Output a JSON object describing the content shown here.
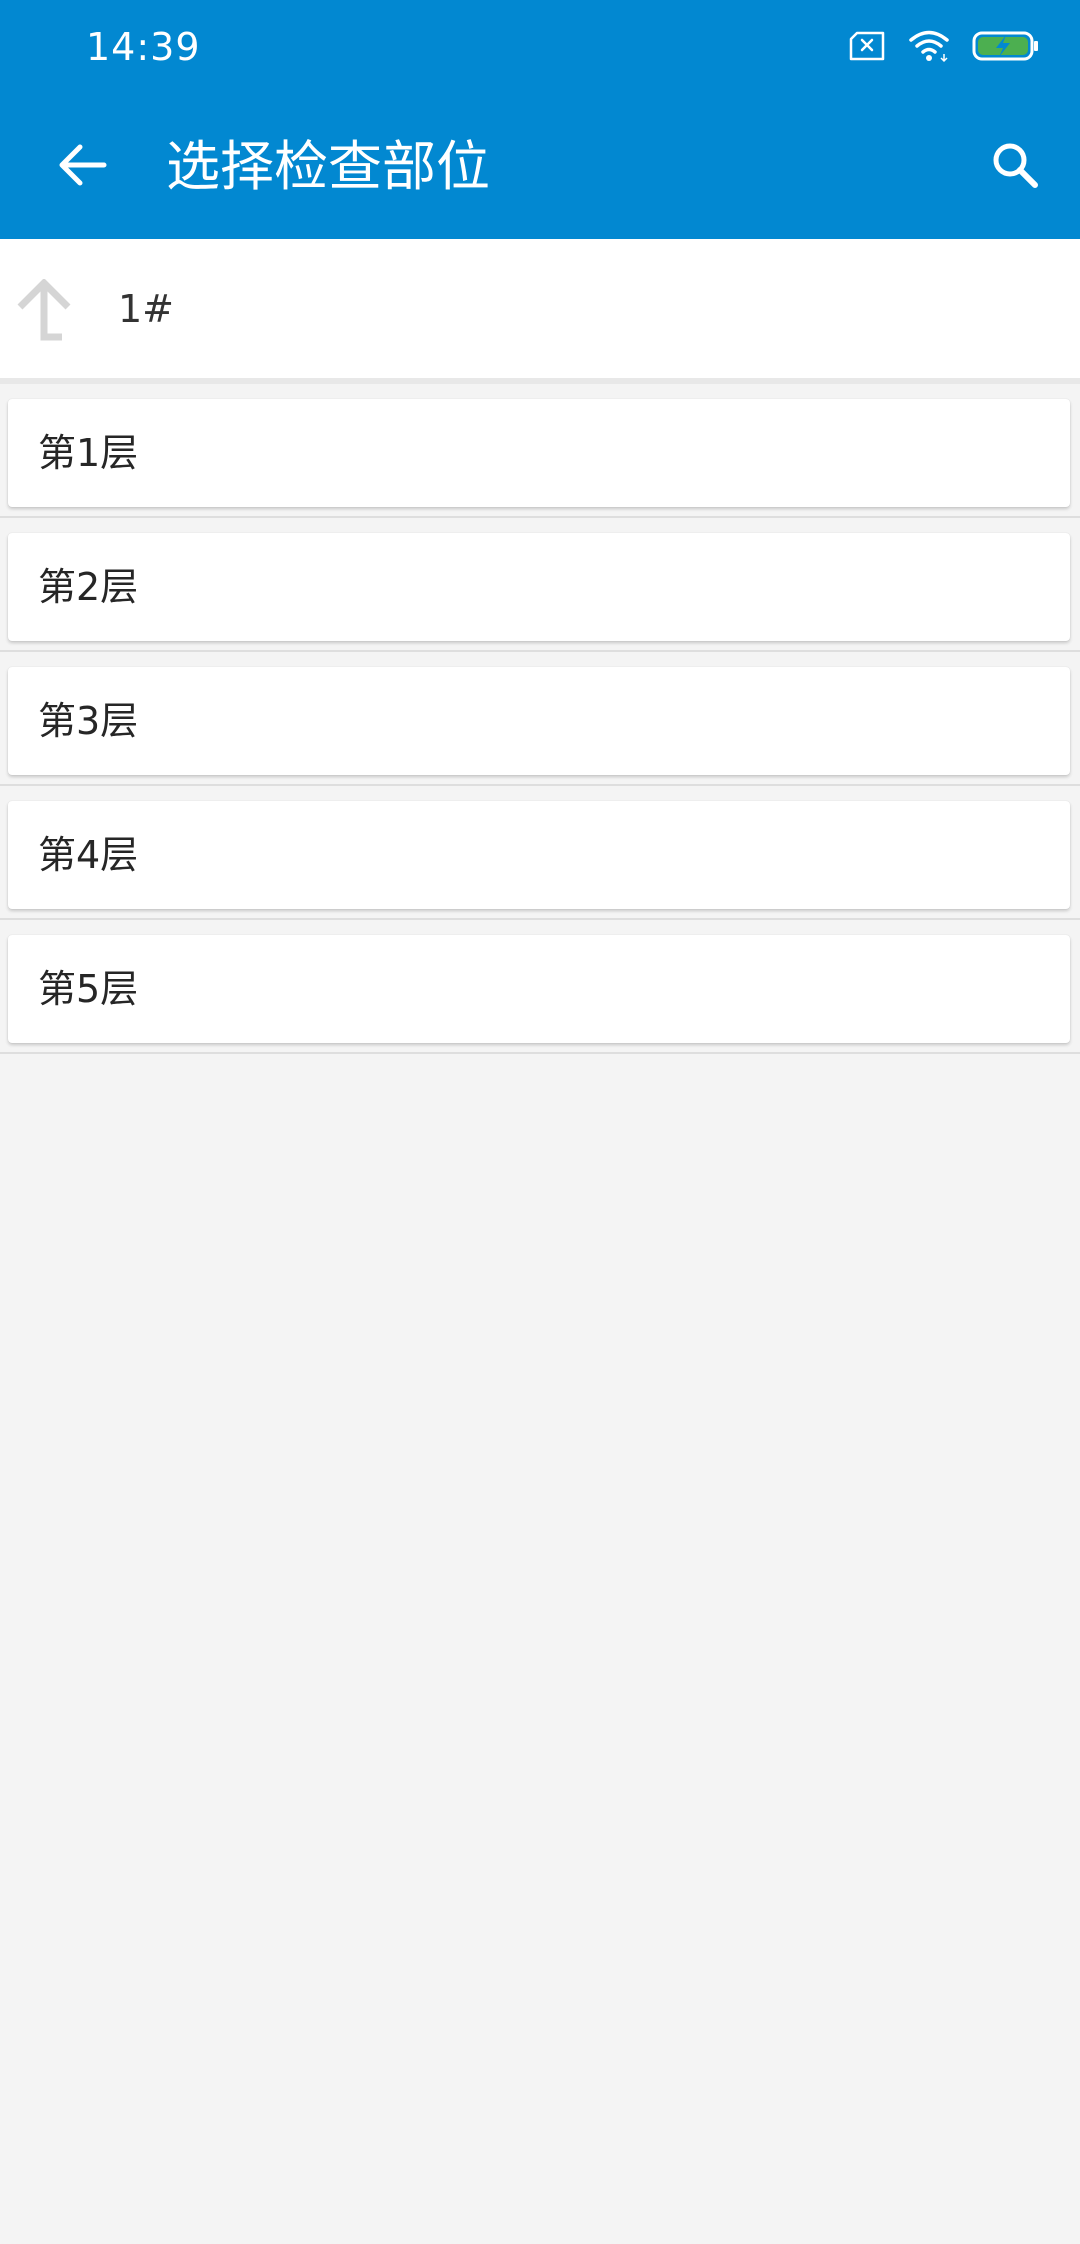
{
  "status_bar": {
    "time": "14:39",
    "icons": [
      "sim-error-icon",
      "wifi-icon",
      "battery-charging-icon"
    ]
  },
  "app_bar": {
    "title": "选择检查部位",
    "back_icon": "arrow-left-icon",
    "search_icon": "search-icon"
  },
  "parent": {
    "icon": "level-up-icon",
    "label": "1#"
  },
  "floors": [
    {
      "label": "第1层"
    },
    {
      "label": "第2层"
    },
    {
      "label": "第3层"
    },
    {
      "label": "第4层"
    },
    {
      "label": "第5层"
    }
  ],
  "colors": {
    "primary": "#0288d1",
    "background": "#f4f4f4",
    "card": "#ffffff",
    "battery_fill": "#4caf50"
  }
}
